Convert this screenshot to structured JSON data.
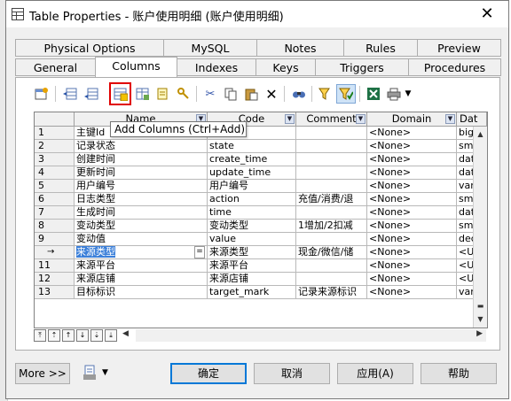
{
  "window": {
    "title": "Table Properties - 账户使用明细 (账户使用明细)"
  },
  "tabs_top": [
    "Physical Options",
    "MySQL",
    "Notes",
    "Rules",
    "Preview"
  ],
  "tabs_bottom": [
    "General",
    "Columns",
    "Indexes",
    "Keys",
    "Triggers",
    "Procedures"
  ],
  "active_tab": "Columns",
  "toolbar": {
    "icons": [
      "properties-icon",
      "insert-row-icon",
      "add-row-icon",
      "add-columns-icon",
      "copy-columns-icon",
      "reuse-icon",
      "cut-icon",
      "copy-icon",
      "paste-icon",
      "delete-icon",
      "find-icon",
      "filter-icon",
      "customize-columns-icon",
      "excel-icon",
      "print-icon",
      "more-dropdown-icon"
    ],
    "tooltip": "Add Columns (Ctrl+Add)"
  },
  "grid": {
    "columns": [
      "Name",
      "Code",
      "Comment",
      "Domain",
      "Dat"
    ],
    "rows": [
      {
        "num": "1",
        "name": "主键Id",
        "code": "",
        "comment": "",
        "domain": "<None>",
        "dtype": "bigin"
      },
      {
        "num": "2",
        "name": "记录状态",
        "code": "state",
        "comment": "",
        "domain": "<None>",
        "dtype": "sma"
      },
      {
        "num": "3",
        "name": "创建时间",
        "code": "create_time",
        "comment": "",
        "domain": "<None>",
        "dtype": "date"
      },
      {
        "num": "4",
        "name": "更新时间",
        "code": "update_time",
        "comment": "",
        "domain": "<None>",
        "dtype": "date"
      },
      {
        "num": "5",
        "name": "用户编号",
        "code": "用户编号",
        "comment": "",
        "domain": "<None>",
        "dtype": "varc"
      },
      {
        "num": "6",
        "name": "日志类型",
        "code": "action",
        "comment": "充值/消费/退",
        "domain": "<None>",
        "dtype": "sma"
      },
      {
        "num": "7",
        "name": "生成时间",
        "code": "time",
        "comment": "",
        "domain": "<None>",
        "dtype": "date"
      },
      {
        "num": "8",
        "name": "变动类型",
        "code": "变动类型",
        "comment": "1增加/2扣减",
        "domain": "<None>",
        "dtype": "sma"
      },
      {
        "num": "9",
        "name": "变动值",
        "code": "value",
        "comment": "",
        "domain": "<None>",
        "dtype": "deci"
      },
      {
        "num": "→",
        "name": "来源类型",
        "code": "来源类型",
        "comment": "现金/微信/储",
        "domain": "<None>",
        "dtype": "<Un"
      },
      {
        "num": "11",
        "name": "来源平台",
        "code": "来源平台",
        "comment": "",
        "domain": "<None>",
        "dtype": "<Un"
      },
      {
        "num": "12",
        "name": "来源店铺",
        "code": "来源店铺",
        "comment": "",
        "domain": "<None>",
        "dtype": "<Un"
      },
      {
        "num": "13",
        "name": "目标标识",
        "code": "target_mark",
        "comment": "记录来源标识",
        "domain": "<None>",
        "dtype": "varc"
      }
    ]
  },
  "footer": {
    "more_label": "More >>",
    "ok_label": "确定",
    "cancel_label": "取消",
    "apply_label": "应用(A)",
    "help_label": "帮助"
  }
}
